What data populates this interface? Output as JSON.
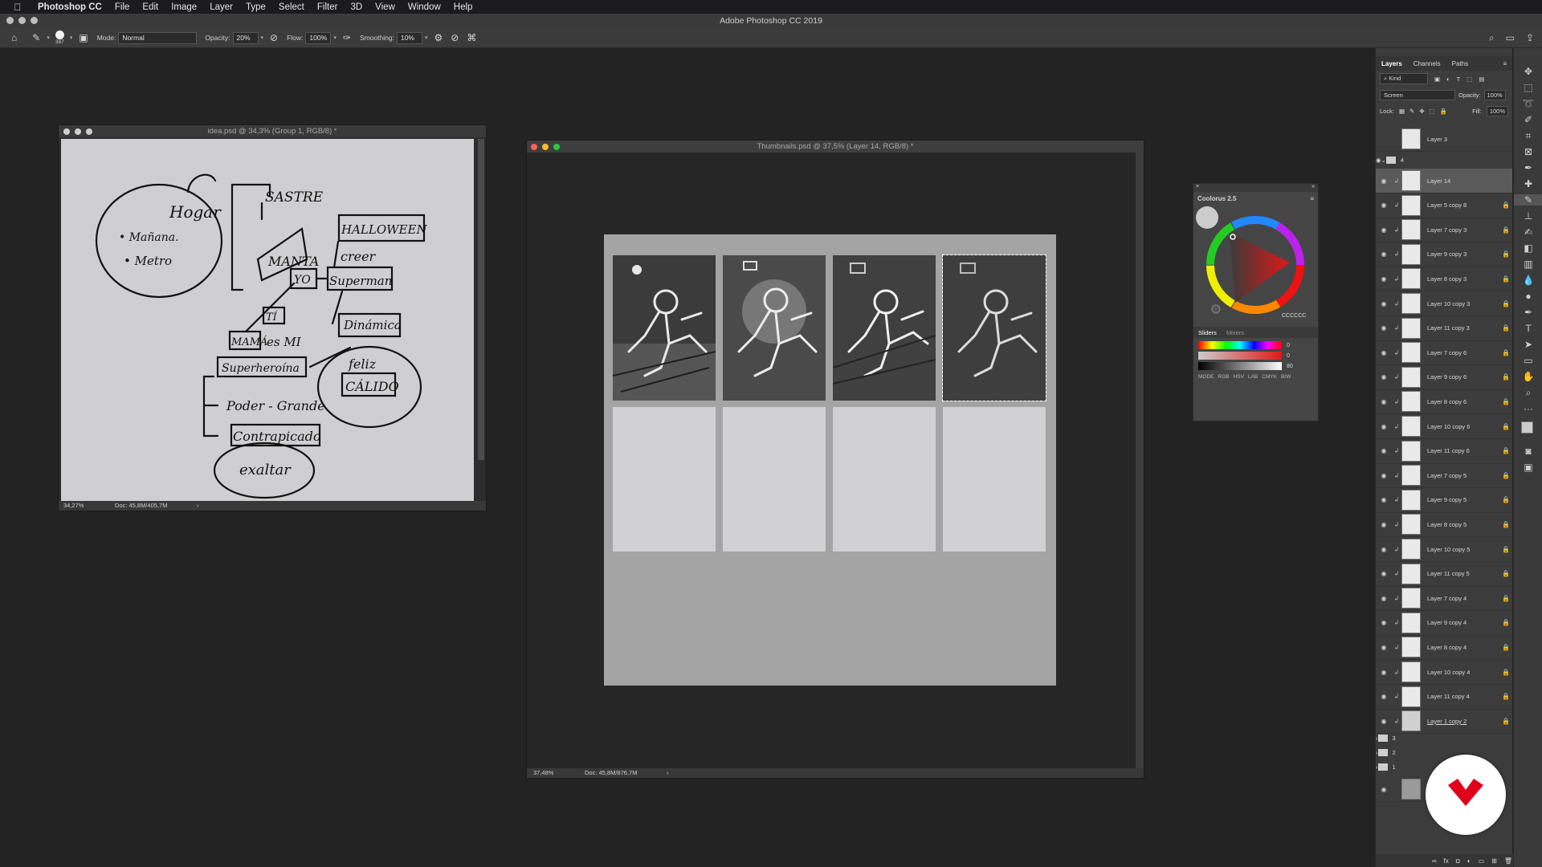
{
  "menubar": {
    "app": "Photoshop CC",
    "items": [
      "File",
      "Edit",
      "Image",
      "Layer",
      "Type",
      "Select",
      "Filter",
      "3D",
      "View",
      "Window",
      "Help"
    ]
  },
  "title": "Adobe Photoshop CC 2019",
  "options": {
    "brush_size": "387",
    "mode_label": "Mode:",
    "mode_value": "Normal",
    "opacity_label": "Opacity:",
    "opacity_value": "20%",
    "flow_label": "Flow:",
    "flow_value": "100%",
    "smoothing_label": "Smoothing:",
    "smoothing_value": "10%"
  },
  "idea_window": {
    "title": "idea.psd @ 34,3% (Group 1, RGB/8) *",
    "zoom": "34,27%",
    "doc": "Doc: 45,8M/405,7M"
  },
  "sketch_words": {
    "hogar": "Hogar",
    "manana": "• Mañana.",
    "metro": "• Metro",
    "sastre": "SASTRE",
    "manta": "MANTA",
    "halloween": "HALLOWEEN",
    "creer": "creer",
    "yo": "YO",
    "superman": "Superman",
    "ti": "TÍ",
    "mama": "MAMÁ",
    "es_mi": "es MI",
    "dinamica": "Dinámica",
    "superheroina": "Superheroína",
    "feliz": "feliz",
    "calido": "CÁLIDO",
    "poder_grande": "Poder - Grande",
    "contrapicado": "Contrapicado",
    "exaltar": "exaltar"
  },
  "thumbs_window": {
    "title": "Thumbnails.psd @ 37,5% (Layer 14, RGB/8) *",
    "zoom": "37,48%",
    "doc": "Doc: 45,8M/876,7M"
  },
  "coolorus": {
    "title": "Coolorus 2.5",
    "hex": "CCCCCC",
    "tab_sliders": "Sliders",
    "tab_mixers": "Mixers",
    "slider_values": [
      "0",
      "0",
      "80"
    ],
    "mode_label": "MODE",
    "modes": [
      "RGB",
      "HSV",
      "LAB",
      "CMYK",
      "B/W"
    ]
  },
  "layers_panel": {
    "tabs": [
      "Layers",
      "Channels",
      "Paths"
    ],
    "kind": "Kind",
    "blend": "Screen",
    "opacity_label": "Opacity:",
    "opacity": "100%",
    "lock_label": "Lock:",
    "fill_label": "Fill:",
    "fill": "100%",
    "top_layer": "Layer 3",
    "group_open": "4",
    "layers": [
      "Layer 14",
      "Layer 5 copy 8",
      "Layer 7 copy 3",
      "Layer 9 copy 3",
      "Layer 8 copy 3",
      "Layer 10 copy 3",
      "Layer 11 copy 3",
      "Layer 7 copy 6",
      "Layer 9 copy 6",
      "Layer 8 copy 6",
      "Layer 10 copy 6",
      "Layer 11 copy 6",
      "Layer 7 copy 5",
      "Layer 9 copy 5",
      "Layer 8 copy 5",
      "Layer 10 copy 5",
      "Layer 11 copy 5",
      "Layer 7 copy 4",
      "Layer 9 copy 4",
      "Layer 8 copy 4",
      "Layer 10 copy 4",
      "Layer 11 copy 4",
      "Layer 1 copy 2"
    ],
    "groups": [
      "3",
      "2",
      "1"
    ],
    "background": "Ba"
  },
  "colors": {
    "accent_red": "#e0001b",
    "ui_dark": "#232323",
    "panel": "#3c3c3c"
  }
}
